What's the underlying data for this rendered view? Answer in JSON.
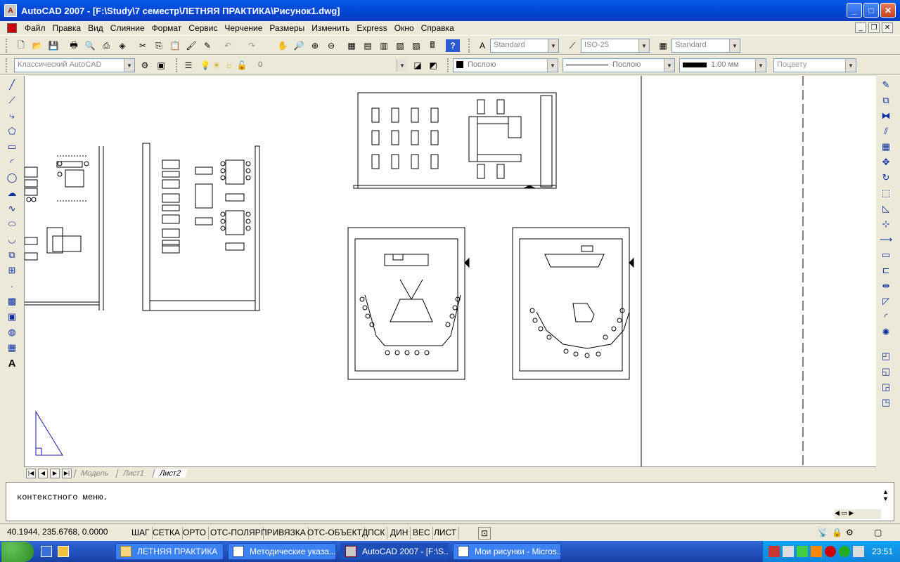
{
  "window": {
    "title": "AutoCAD 2007 - [F:\\Study\\7 семестр\\ЛЕТНЯЯ ПРАКТИКА\\Рисунок1.dwg]",
    "icon": "autocad-icon"
  },
  "menu": [
    "Файл",
    "Правка",
    "Вид",
    "Слияние",
    "Формат",
    "Сервис",
    "Черчение",
    "Размеры",
    "Изменить",
    "Express",
    "Окно",
    "Справка"
  ],
  "toolbar": {
    "text_style": "Standard",
    "dim_style": "ISO-25",
    "table_style": "Standard",
    "workspace": "Классический AutoCAD",
    "layer": "0",
    "color": "Послою",
    "linetype": "Послою",
    "lineweight": "1.00 мм",
    "plotstyle": "Поцвету"
  },
  "layout_tabs": [
    "Модель",
    "Лист1",
    "Лист2"
  ],
  "active_tab": "Лист2",
  "command": {
    "history": "контекстного меню."
  },
  "status": {
    "coordinates": "40.1944,  235.6768, 0.0000",
    "toggles": [
      "ШАГ",
      "СЕТКА",
      "ОРТО",
      "ОТС-ПОЛЯР",
      "ПРИВЯЗКА",
      "ОТС-ОБЪЕКТ",
      "ДПСК",
      "ДИН",
      "ВЕС",
      "ЛИСТ"
    ]
  },
  "taskbar": {
    "tasks": [
      {
        "label": "ЛЕТНЯЯ ПРАКТИКА",
        "active": false
      },
      {
        "label": "Методические указа...",
        "active": false
      },
      {
        "label": "AutoCAD 2007 - [F:\\S...",
        "active": true
      },
      {
        "label": "Мои рисунки - Micros...",
        "active": false
      }
    ],
    "clock": "23:51"
  },
  "colors": {
    "title_bar": "#0046d5",
    "canvas": "#ffffff",
    "ucs_icon": "#1a1aa8"
  }
}
